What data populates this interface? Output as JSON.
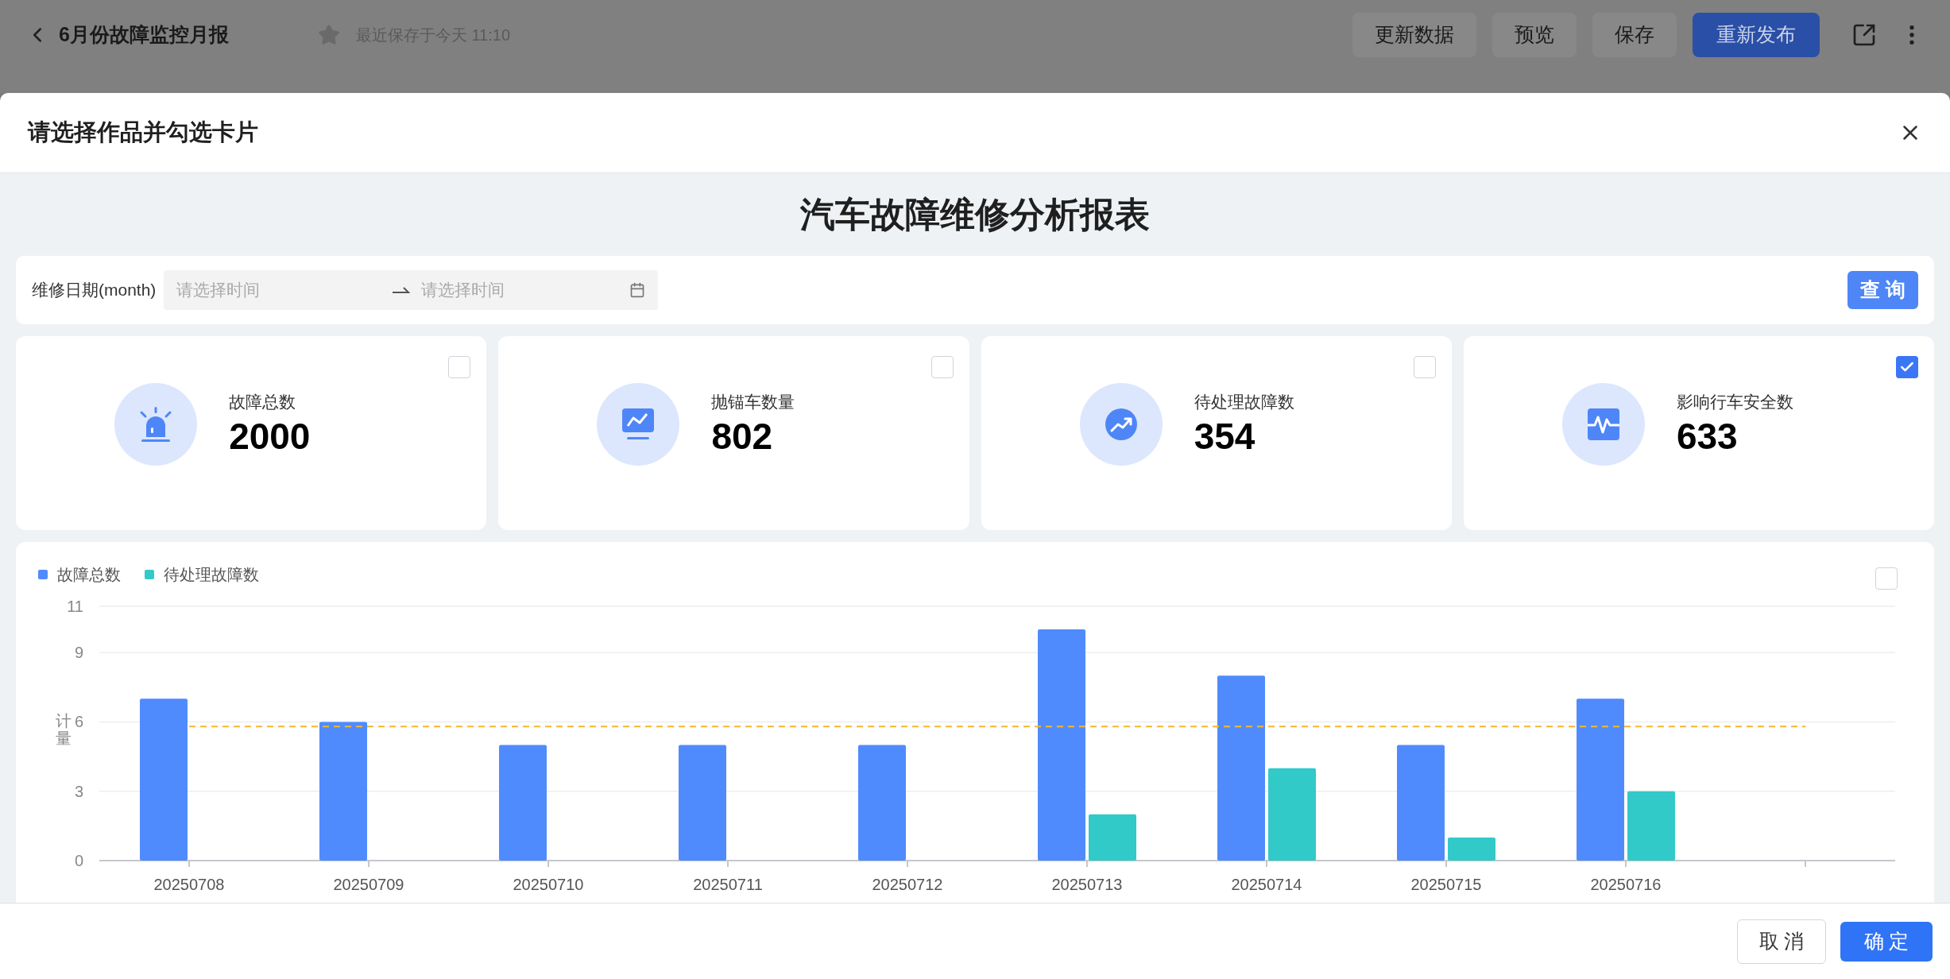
{
  "page": {
    "title": "6月份故障监控月报",
    "starred": false,
    "saved_note": "最近保存于今天 11:10",
    "buttons": [
      {
        "label": "更新数据",
        "kind": "plain"
      },
      {
        "label": "预览",
        "kind": "plain"
      },
      {
        "label": "保存",
        "kind": "plain"
      },
      {
        "label": "重新发布",
        "kind": "primary"
      }
    ]
  },
  "dialog": {
    "title": "请选择作品并勾选卡片",
    "report": {
      "title": "汽车故障维修分析报表",
      "filter": {
        "label": "维修日期(month)",
        "start_placeholder": "请选择时间",
        "end_placeholder": "请选择时间",
        "query_button": "查 询"
      },
      "cards": [
        {
          "kind": "alarm",
          "label": "故障总数",
          "value": "2000",
          "checked": false
        },
        {
          "kind": "monitor",
          "label": "抛锚车数量",
          "value": "802",
          "checked": false
        },
        {
          "kind": "trend",
          "label": "待处理故障数",
          "value": "354",
          "checked": false
        },
        {
          "kind": "pulse",
          "label": "影响行车安全数",
          "value": "633",
          "checked": true
        }
      ],
      "chart": {
        "checked": false,
        "chart_data": {
          "type": "bar",
          "ylabel": "计量",
          "categories": [
            "20250708",
            "20250709",
            "20250710",
            "20250711",
            "20250712",
            "20250713",
            "20250714",
            "20250715",
            "20250716"
          ],
          "series": [
            {
              "name": "故障总数",
              "color": "#508bfe",
              "values": [
                7,
                6,
                5,
                5,
                5,
                10,
                8,
                5,
                7
              ]
            },
            {
              "name": "待处理故障数",
              "color": "#32c9c9",
              "values": [
                0,
                0,
                0,
                0,
                0,
                2,
                4,
                1,
                3
              ]
            }
          ],
          "ylim": [
            0,
            11
          ],
          "yticks": [
            0,
            3,
            6,
            9,
            11
          ],
          "grid": true,
          "ref_lines": [
            {
              "axis": "y",
              "value": 5.8,
              "color": "#f5b72c"
            }
          ]
        }
      }
    },
    "buttons": [
      {
        "label": "取 消",
        "kind": "plain"
      },
      {
        "label": "确 定",
        "kind": "primary"
      }
    ]
  }
}
